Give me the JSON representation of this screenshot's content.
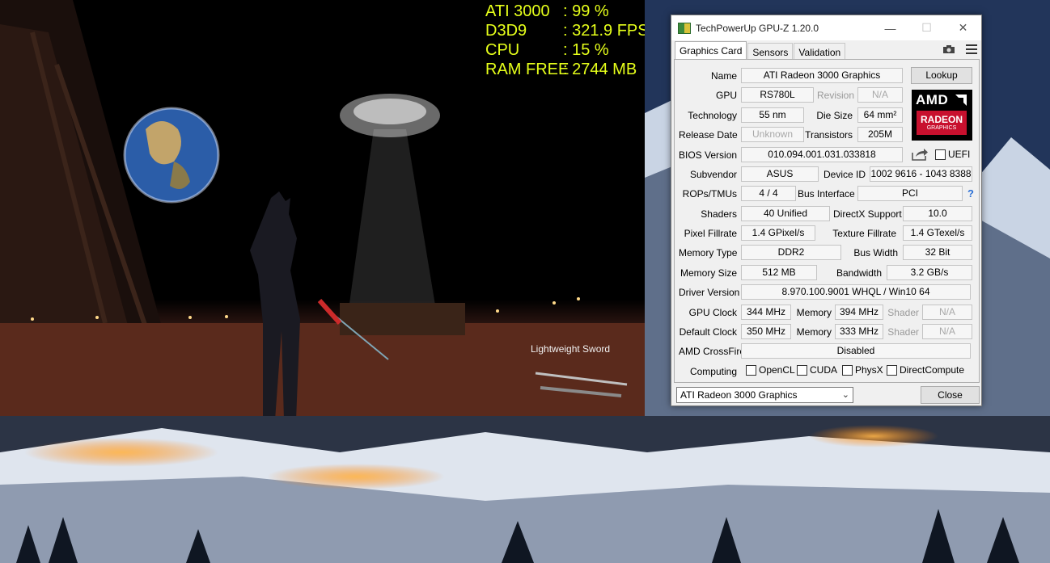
{
  "osd": [
    {
      "label": "ATI 3000",
      "value": ": 99 %"
    },
    {
      "label": "D3D9",
      "value": ": 321.9 FPS"
    },
    {
      "label": "CPU",
      "value": ": 15 %"
    },
    {
      "label": "RAM FREE",
      "value": ": 2744 MB"
    }
  ],
  "game": {
    "item_caption": "Lightweight Sword"
  },
  "gpuz": {
    "title": "TechPowerUp GPU-Z 1.20.0",
    "tabs": [
      "Graphics Card",
      "Sensors",
      "Validation"
    ],
    "labels": {
      "name": "Name",
      "gpu": "GPU",
      "revision": "Revision",
      "technology": "Technology",
      "die_size": "Die Size",
      "release_date": "Release Date",
      "transistors": "Transistors",
      "bios_version": "BIOS Version",
      "uefi": "UEFI",
      "subvendor": "Subvendor",
      "device_id": "Device ID",
      "rops": "ROPs/TMUs",
      "bus_interface": "Bus Interface",
      "shaders": "Shaders",
      "directx": "DirectX Support",
      "pixel_fillrate": "Pixel Fillrate",
      "texture_fillrate": "Texture Fillrate",
      "memory_type": "Memory Type",
      "bus_width": "Bus Width",
      "memory_size": "Memory Size",
      "bandwidth": "Bandwidth",
      "driver_version": "Driver Version",
      "gpu_clock": "GPU Clock",
      "memory": "Memory",
      "shader": "Shader",
      "default_clock": "Default Clock",
      "crossfire": "AMD CrossFire",
      "computing": "Computing"
    },
    "values": {
      "name": "ATI Radeon 3000 Graphics",
      "gpu": "RS780L",
      "revision": "N/A",
      "technology": "55 nm",
      "die_size": "64 mm²",
      "release_date": "Unknown",
      "transistors": "205M",
      "bios_version": "010.094.001.031.033818",
      "subvendor": "ASUS",
      "device_id": "1002 9616 - 1043 8388",
      "rops": "4 / 4",
      "bus_interface": "PCI",
      "shaders": "40 Unified",
      "directx": "10.0",
      "pixel_fillrate": "1.4 GPixel/s",
      "texture_fillrate": "1.4 GTexel/s",
      "memory_type": "DDR2",
      "bus_width": "32 Bit",
      "memory_size": "512 MB",
      "bandwidth": "3.2 GB/s",
      "driver_version": "8.970.100.9001 WHQL / Win10 64",
      "gpu_clock": "344 MHz",
      "gpu_memory": "394 MHz",
      "gpu_shader": "N/A",
      "default_clock": "350 MHz",
      "default_memory": "333 MHz",
      "default_shader": "N/A",
      "crossfire": "Disabled"
    },
    "computing": [
      "OpenCL",
      "CUDA",
      "PhysX",
      "DirectCompute"
    ],
    "lookup_label": "Lookup",
    "logo": {
      "brand": "AMD",
      "product": "RADEON",
      "sub": "GRAPHICS",
      "accent": "#c8102e"
    },
    "selected_gpu": "ATI Radeon 3000 Graphics",
    "close_label": "Close",
    "icons": [
      "camera-icon",
      "hamburger-menu-icon",
      "share-icon",
      "help-icon"
    ]
  }
}
